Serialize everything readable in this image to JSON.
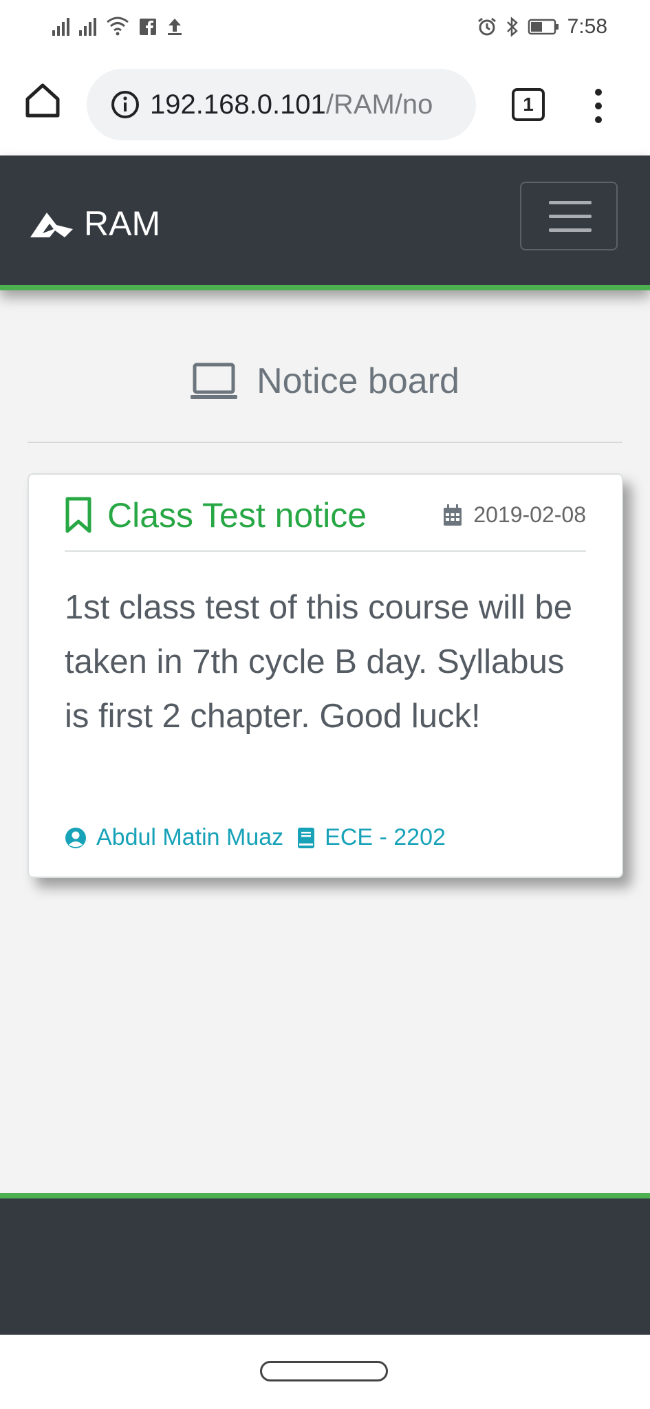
{
  "status_bar": {
    "time": "7:58"
  },
  "browser": {
    "url_host": "192.168.0.101",
    "url_path": "/RAM/no",
    "tab_count": "1"
  },
  "navbar": {
    "brand": "RAM"
  },
  "page": {
    "heading": "Notice board"
  },
  "notice": {
    "title": "Class Test notice",
    "date": "2019-02-08",
    "body": "1st class test of this course will be taken in 7th cycle B day. Syllabus is first 2 chapter. Good luck!",
    "author": "Abdul Matin Muaz",
    "course": "ECE - 2202"
  },
  "colors": {
    "navbar": "#343a40",
    "accent_green": "#4caf50",
    "title_green": "#28a745",
    "meta_teal": "#17a2b8"
  },
  "icons": {
    "heading": "laptop-icon",
    "title": "bookmark-icon",
    "date": "calendar-icon",
    "author": "user-circle-icon",
    "course": "book-icon"
  }
}
